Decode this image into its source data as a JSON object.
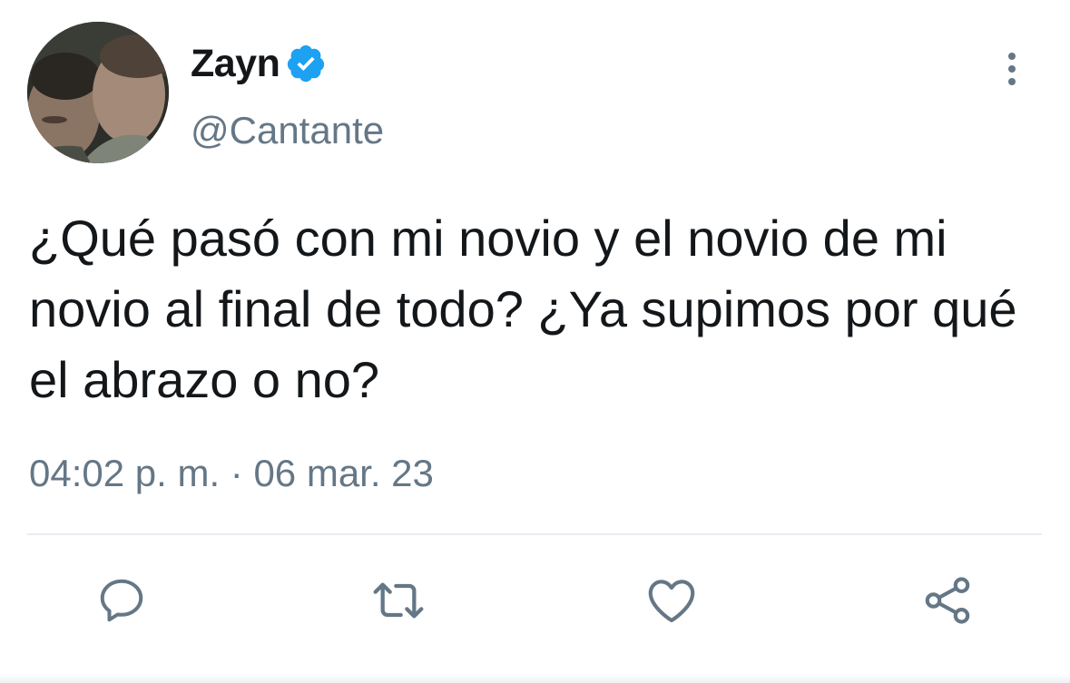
{
  "tweet": {
    "author": {
      "display_name": "Zayn",
      "handle": "@Cantante",
      "verified": true,
      "avatar_description": "avatar-photo"
    },
    "text": "¿Qué pasó con mi novio y el novio de mi novio al final de todo? ¿Ya supimos por qué el abrazo o no?",
    "timestamp": "04:02 p. m. · 06 mar. 23",
    "actions": [
      "reply-icon",
      "retweet-icon",
      "like-icon",
      "share-icon"
    ]
  },
  "colors": {
    "text_primary": "#14171a",
    "text_secondary": "#657786",
    "verified_blue": "#1da1f2",
    "divider": "#e6ecf0"
  }
}
